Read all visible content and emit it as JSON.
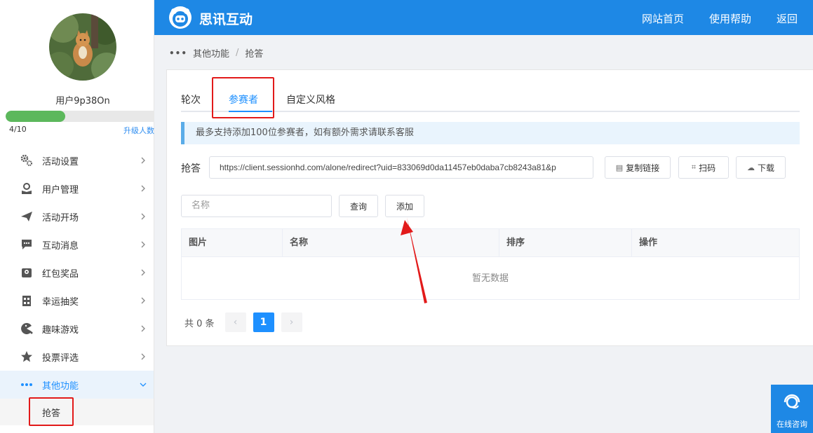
{
  "user": {
    "name": "用户9p38On",
    "quota": "4/10",
    "quota_fraction": 0.4,
    "upgrade": "升级人数"
  },
  "header": {
    "brand": "思讯互动",
    "nav": [
      "网站首页",
      "使用帮助",
      "返回"
    ]
  },
  "sidebar": {
    "items": [
      {
        "label": "活动设置",
        "icon": "gears-icon"
      },
      {
        "label": "用户管理",
        "icon": "user-icon"
      },
      {
        "label": "活动开场",
        "icon": "paper-plane-icon"
      },
      {
        "label": "互动消息",
        "icon": "chat-icon"
      },
      {
        "label": "红包奖品",
        "icon": "gift-icon"
      },
      {
        "label": "幸运抽奖",
        "icon": "lottery-icon"
      },
      {
        "label": "趣味游戏",
        "icon": "game-icon"
      },
      {
        "label": "投票评选",
        "icon": "star-icon"
      },
      {
        "label": "其他功能",
        "icon": "more-icon",
        "active": true
      }
    ],
    "subitem": "抢答"
  },
  "breadcrumb": {
    "parent": "其他功能",
    "current": "抢答"
  },
  "tabs": [
    "轮次",
    "参赛者",
    "自定义风格"
  ],
  "active_tab": 1,
  "notice": "最多支持添加100位参赛者，如有额外需求请联系客服",
  "link": {
    "label": "抢答",
    "url": "https://client.sessionhd.com/alone/redirect?uid=833069d0da11457eb0daba7cb8243a81&p",
    "copy": "复制链接",
    "scan": "扫码",
    "download": "下载"
  },
  "search": {
    "placeholder": "名称",
    "query_button": "查询",
    "add_button": "添加"
  },
  "table": {
    "columns": [
      "图片",
      "名称",
      "排序",
      "操作"
    ],
    "empty": "暂无数据"
  },
  "pagination": {
    "total": "共 0 条",
    "current_page": "1",
    "prev": "‹",
    "next": "›"
  },
  "support": {
    "label": "在线咨询"
  },
  "colors": {
    "header": "#1e88e5",
    "accent": "#1e90ff",
    "highlight": "#e21a1a",
    "progress": "#5cb85c"
  }
}
